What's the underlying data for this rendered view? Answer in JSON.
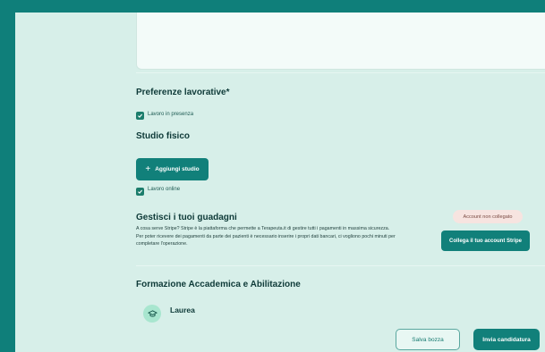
{
  "preferences": {
    "title": "Preferenze lavorative*",
    "in_person_label": "Lavoro in presenza",
    "studio_title": "Studio fisico",
    "add_studio_label": "Aggiungi studio",
    "online_label": "Lavoro online"
  },
  "earnings": {
    "title": "Gestisci i tuoi guadagni",
    "description": "A cosa serve Stripe? Stripe è la piattaforma che permette a Terapeuta.it di gestire tutti i pagamenti in massima sicurezza. Per poter ricevere dei pagamenti da parte dei pazienti è necessario inserire i propri dati bancari, ci vogliono pochi minuti per completare l'operazione.",
    "status_badge": "Account non collegato",
    "connect_button": "Collega il tuo account Stripe"
  },
  "education": {
    "title": "Formazione Accademica e Abilitazione",
    "item_label": "Laurea"
  },
  "footer": {
    "save_draft": "Salva bozza",
    "submit": "Invia candidatura"
  },
  "colors": {
    "frame": "#0f7f7a",
    "page_bg": "#d7efe9",
    "primary": "#11807a"
  }
}
